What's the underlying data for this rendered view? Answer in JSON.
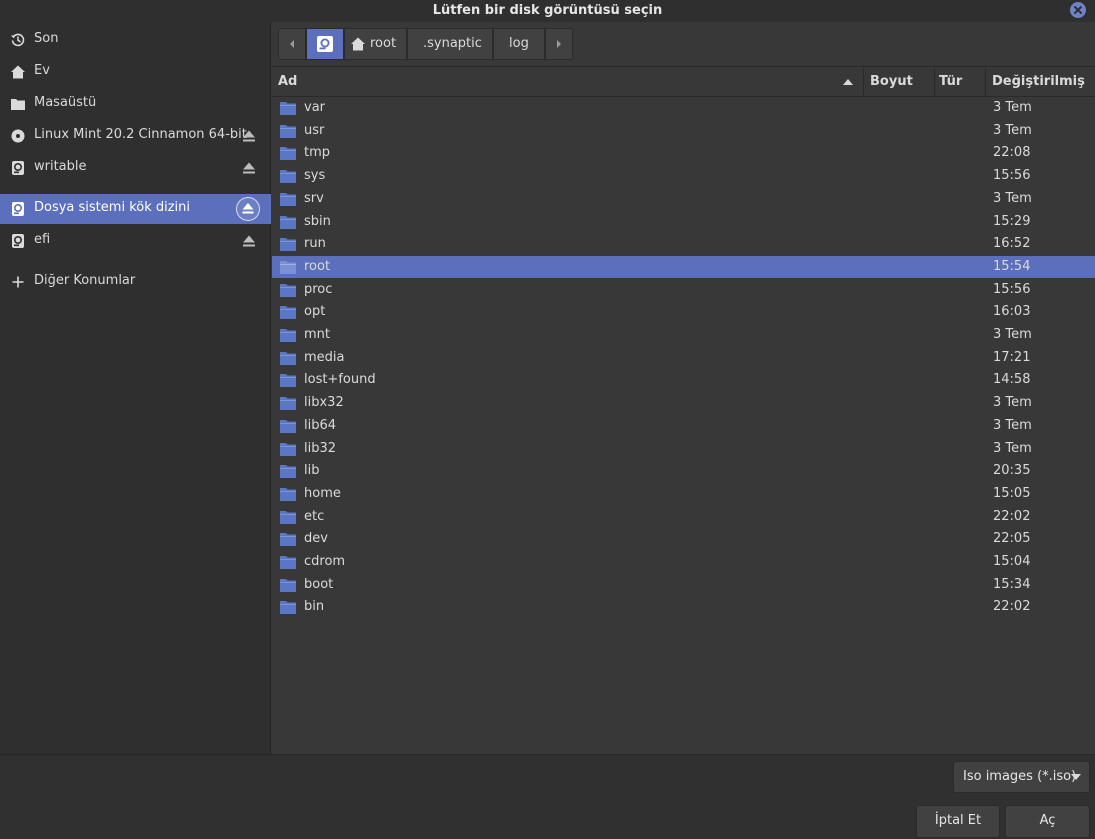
{
  "window": {
    "title": "Lütfen bir disk görüntüsü seçin"
  },
  "sidebar": {
    "items": [
      {
        "label": "Son",
        "icon": "history-icon"
      },
      {
        "label": "Ev",
        "icon": "home-icon"
      },
      {
        "label": "Masaüstü",
        "icon": "folder-icon"
      },
      {
        "label": "Linux Mint 20.2 Cinnamon 64-bit",
        "icon": "optical-disc-icon",
        "ejectable": true
      },
      {
        "label": "writable",
        "icon": "drive-icon",
        "ejectable": true
      },
      {
        "label": "Dosya sistemi kök dizini",
        "icon": "drive-icon",
        "ejectable": true,
        "selected": true
      },
      {
        "label": "efi",
        "icon": "drive-icon",
        "ejectable": true
      },
      {
        "label": "Diğer Konumlar",
        "icon": "plus-icon"
      }
    ]
  },
  "pathbar": {
    "segments": [
      "root",
      ".synaptic",
      "log"
    ],
    "back_icon": "chevron-left-icon",
    "forward_icon": "chevron-right-icon",
    "root_icon": "drive-icon",
    "home_icon": "home-icon"
  },
  "columns": {
    "name": "Ad",
    "size": "Boyut",
    "type": "Tür",
    "modified": "Değiştirilmiş",
    "sort_icon": "sort-ascending-icon"
  },
  "files": [
    {
      "name": "var",
      "modified": "3 Tem"
    },
    {
      "name": "usr",
      "modified": "3 Tem"
    },
    {
      "name": "tmp",
      "modified": "22:08"
    },
    {
      "name": "sys",
      "modified": "15:56"
    },
    {
      "name": "srv",
      "modified": "3 Tem"
    },
    {
      "name": "sbin",
      "modified": "15:29"
    },
    {
      "name": "run",
      "modified": "16:52"
    },
    {
      "name": "root",
      "modified": "15:54",
      "selected": true
    },
    {
      "name": "proc",
      "modified": "15:56"
    },
    {
      "name": "opt",
      "modified": "16:03"
    },
    {
      "name": "mnt",
      "modified": "3 Tem"
    },
    {
      "name": "media",
      "modified": "17:21"
    },
    {
      "name": "lost+found",
      "modified": "14:58"
    },
    {
      "name": "libx32",
      "modified": "3 Tem"
    },
    {
      "name": "lib64",
      "modified": "3 Tem"
    },
    {
      "name": "lib32",
      "modified": "3 Tem"
    },
    {
      "name": "lib",
      "modified": "20:35"
    },
    {
      "name": "home",
      "modified": "15:05"
    },
    {
      "name": "etc",
      "modified": "22:02"
    },
    {
      "name": "dev",
      "modified": "22:05"
    },
    {
      "name": "cdrom",
      "modified": "15:04"
    },
    {
      "name": "boot",
      "modified": "15:34"
    },
    {
      "name": "bin",
      "modified": "22:02"
    }
  ],
  "footer": {
    "filter": "Iso images (*.iso)",
    "cancel_label": "İptal Et",
    "open_label": "Aç"
  },
  "colors": {
    "accent": "#5b6fbc",
    "folder": "#5b76c4",
    "background": "#383838",
    "sidebar": "#2f2f2f"
  }
}
